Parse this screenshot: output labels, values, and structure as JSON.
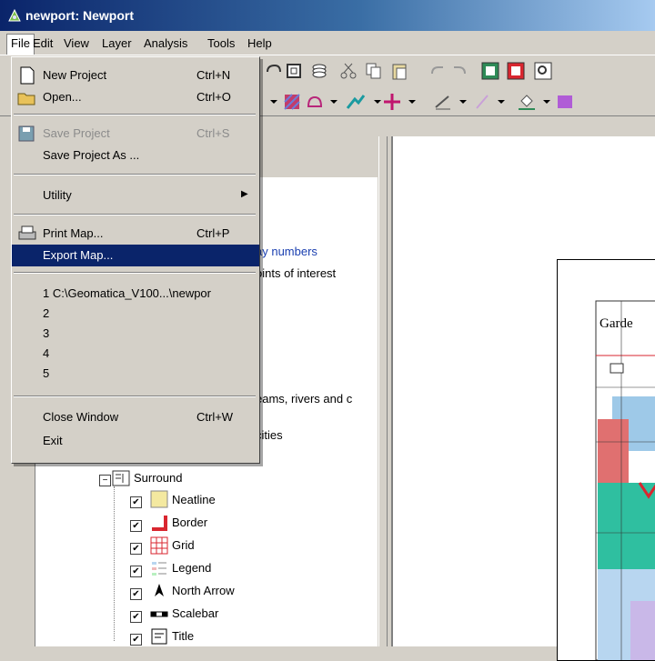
{
  "window": {
    "title": "newport: Newport"
  },
  "menubar": [
    "File",
    "Edit",
    "View",
    "Layer",
    "Analysis",
    "Tools",
    "Help"
  ],
  "file_menu": {
    "new_project": {
      "label": "New Project",
      "shortcut": "Ctrl+N"
    },
    "open": {
      "label": "Open...",
      "shortcut": "Ctrl+O"
    },
    "save_project": {
      "label": "Save Project",
      "shortcut": "Ctrl+S"
    },
    "save_project_as": {
      "label": "Save Project As ..."
    },
    "utility": {
      "label": "Utility"
    },
    "print_map": {
      "label": "Print Map...",
      "shortcut": "Ctrl+P"
    },
    "export_map": {
      "label": "Export Map..."
    },
    "recent": [
      "1 C:\\Geomatica_V100...\\newpor",
      "2",
      "3",
      "4",
      "5"
    ],
    "close_window": {
      "label": "Close Window",
      "shortcut": "Ctrl+W"
    },
    "exit": {
      "label": "Exit"
    }
  },
  "tree": {
    "partial": [
      "ay numbers",
      "oints of interest",
      "eams, rivers and c",
      "cities"
    ],
    "surround": "Surround",
    "children": [
      "Neatline",
      "Border",
      "Grid",
      "Legend",
      "North Arrow",
      "Scalebar",
      "Title"
    ]
  },
  "map": {
    "label": "Garde"
  }
}
